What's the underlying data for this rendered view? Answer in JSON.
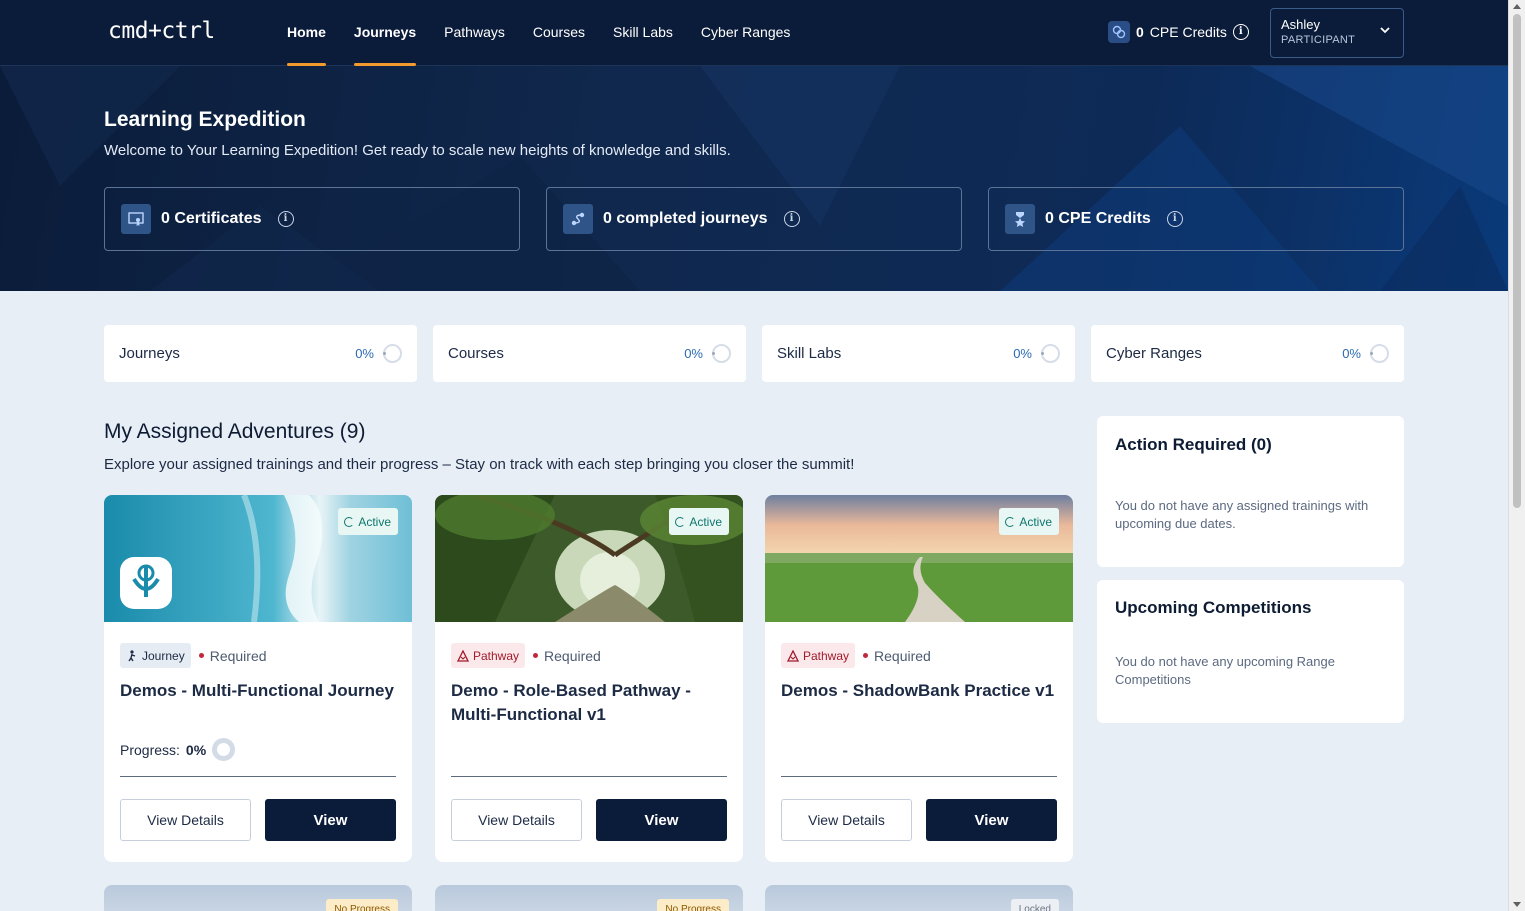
{
  "nav": {
    "logo": "cmd+ctrl",
    "links": [
      "Home",
      "Journeys",
      "Pathways",
      "Courses",
      "Skill Labs",
      "Cyber Ranges"
    ],
    "cpe_value": "0",
    "cpe_label": "CPE Credits",
    "user_name": "Ashley",
    "user_role": "PARTICIPANT"
  },
  "hero": {
    "title": "Learning Expedition",
    "subtitle": "Welcome to Your Learning Expedition! Get ready to scale new heights of knowledge and skills.",
    "stats": [
      {
        "label": "0 Certificates",
        "icon": "certificate-icon"
      },
      {
        "label": "0 completed journeys",
        "icon": "journey-path-icon"
      },
      {
        "label": "0 CPE Credits",
        "icon": "award-ribbon-icon"
      }
    ]
  },
  "progress_tiles": [
    {
      "label": "Journeys",
      "percent": "0%"
    },
    {
      "label": "Courses",
      "percent": "0%"
    },
    {
      "label": "Skill Labs",
      "percent": "0%"
    },
    {
      "label": "Cyber Ranges",
      "percent": "0%"
    }
  ],
  "adventures": {
    "title": "My Assigned Adventures (9)",
    "subtitle": "Explore your assigned trainings and their progress – Stay on track with each step bringing you closer the summit!",
    "cards": [
      {
        "status": "Active",
        "type": "Journey",
        "requirement": "Required",
        "title": "Demos - Multi-Functional Journey",
        "progress_label": "Progress:",
        "progress_value": "0%",
        "btn_details": "View Details",
        "btn_view": "View"
      },
      {
        "status": "Active",
        "type": "Pathway",
        "requirement": "Required",
        "title": "Demo - Role-Based Pathway - Multi-Functional v1",
        "btn_details": "View Details",
        "btn_view": "View"
      },
      {
        "status": "Active",
        "type": "Pathway",
        "requirement": "Required",
        "title": "Demos - ShadowBank Practice v1",
        "btn_details": "View Details",
        "btn_view": "View"
      }
    ],
    "more_cards": [
      {
        "status": "No Progress"
      },
      {
        "status": "No Progress"
      },
      {
        "status": "Locked"
      }
    ]
  },
  "sidebar": {
    "action_title": "Action Required (0)",
    "action_text": "You do not have any assigned trainings with upcoming due dates.",
    "comp_title": "Upcoming Competitions",
    "comp_text": "You do not have any upcoming Range Competitions"
  },
  "colors": {
    "navy": "#0b1c3a",
    "accent_orange": "#f39a2e",
    "active_teal": "#0f766e",
    "required_red": "#c0283b"
  }
}
